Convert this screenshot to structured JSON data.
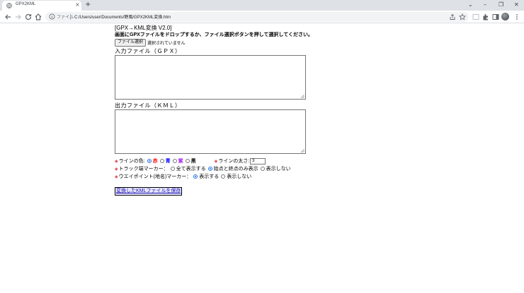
{
  "browser": {
    "tab_title": "GPX2KML",
    "tab_close": "×",
    "new_tab": "+",
    "window_controls": [
      "⌄",
      "–",
      "❐",
      "✕"
    ],
    "omnibox": {
      "scheme_label": "ファイル",
      "url": "C:/Users/user/Documents/野風/GPX2KML変換.htm"
    }
  },
  "page": {
    "title": "[GPX→KML変換 V2.0]",
    "instruction": "画面にGPXファイルをドロップするか、ファイル選択ボタンを押して選択してください。",
    "file_button": "ファイル選択",
    "file_status": "選択されていません",
    "input_label": "入力ファイル（ＧＰＸ）",
    "output_label": "出力ファイル（ＫＭＬ）",
    "line_color": {
      "marker": "◆",
      "label": "ラインの色:",
      "options": [
        {
          "label": "赤",
          "color": "#ff0000",
          "selected": true
        },
        {
          "label": "青",
          "color": "#0000ff",
          "selected": false
        },
        {
          "label": "紫",
          "color": "#a020f0",
          "selected": false
        },
        {
          "label": "黒",
          "color": "#000000",
          "selected": false
        }
      ]
    },
    "line_width": {
      "marker": "◆",
      "label": "ラインの太さ:",
      "value": "3"
    },
    "track_marker": {
      "marker": "◆",
      "label": "トラック端マーカー：",
      "options": [
        {
          "label": "全て表示する",
          "selected": false
        },
        {
          "label": "始点と終点のみ表示",
          "selected": true
        },
        {
          "label": "表示しない",
          "selected": false
        }
      ]
    },
    "waypoint_marker": {
      "marker": "◆",
      "label": "ウエイポイント(地名)マーカー：",
      "options": [
        {
          "label": "表示する",
          "selected": true
        },
        {
          "label": "表示しない",
          "selected": false
        }
      ]
    },
    "save_button": "変換したKMLファイルを保存"
  }
}
